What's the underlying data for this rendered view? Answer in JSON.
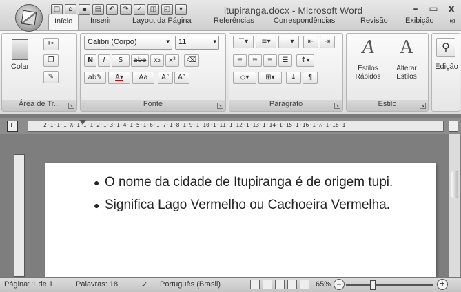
{
  "window": {
    "title": "itupiranga.docx - Microsoft Word",
    "minimize": "–",
    "maximize": "▭",
    "close": "x"
  },
  "tabs": [
    "Início",
    "Inserir",
    "Layout da Página",
    "Referências",
    "Correspondências",
    "Revisão",
    "Exibição"
  ],
  "ribbon": {
    "clipboard": {
      "paste": "Colar",
      "label": "Área de Tr..."
    },
    "font": {
      "name": "Calibri (Corpo)",
      "size": "11",
      "label": "Fonte",
      "bold": "N",
      "italic": "I",
      "underline": "S",
      "strike": "abe",
      "subscript": "x₂",
      "superscript": "x²",
      "change_case": "Aa",
      "grow": "A˄",
      "shrink": "A˅"
    },
    "paragraph": {
      "label": "Parágrafo"
    },
    "styles": {
      "quick": "Estilos Rápidos",
      "change": "Alterar Estilos",
      "label": "Estilo"
    },
    "editing": {
      "label": "Edição"
    }
  },
  "ruler": {
    "marks": "2·1·1·1·X·1·1·1·2·1·3·1·4·1·5·1·6·1·7·1·8·1·9·1·10·1·11·1·12·1·13·1·14·1·15·1·16·1·△·1·18·1·"
  },
  "document": {
    "bullets": [
      "O nome da cidade de Itupiranga é de origem tupi.",
      "Significa Lago Vermelho ou Cachoeira Vermelha."
    ]
  },
  "status": {
    "page": "Página: 1 de 1",
    "words": "Palavras: 18",
    "language": "Português (Brasil)",
    "zoom": "65%",
    "zoom_level": 0.65
  }
}
